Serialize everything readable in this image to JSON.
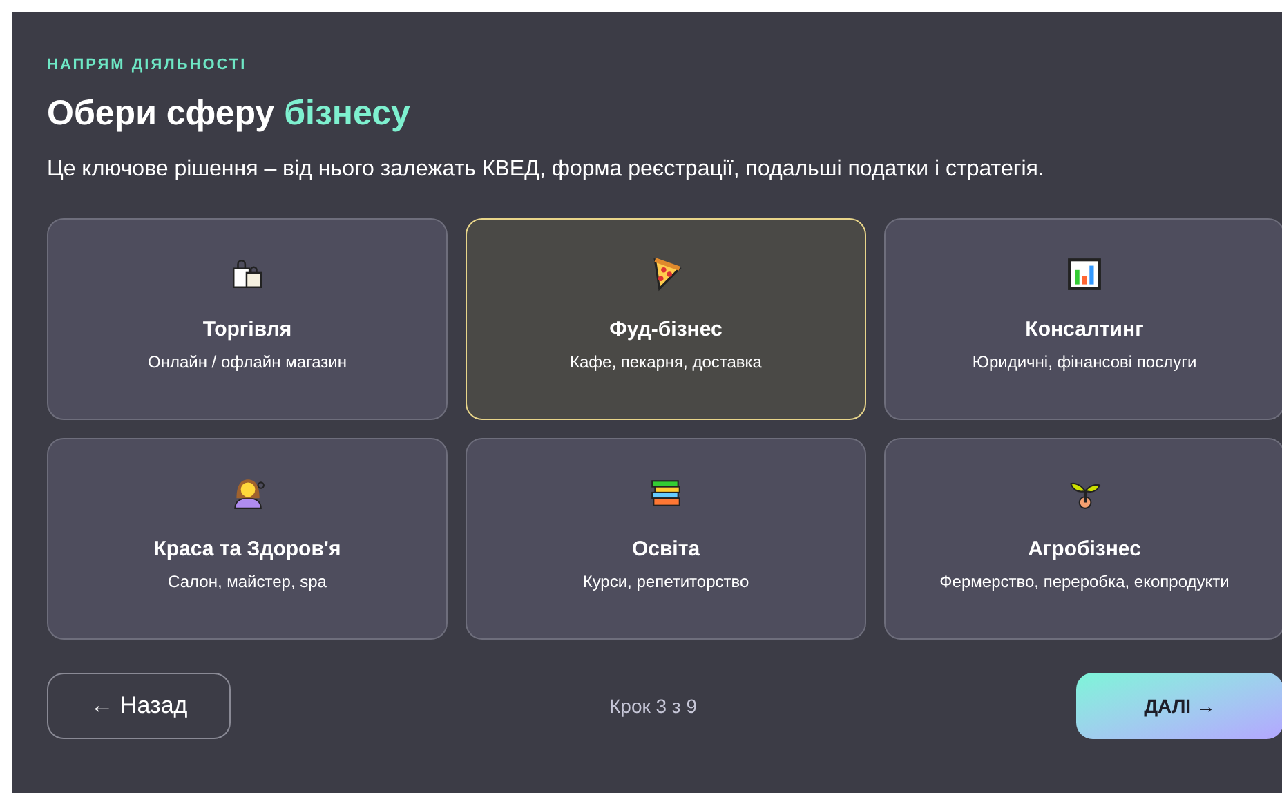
{
  "eyebrow": "НАПРЯМ ДІЯЛЬНОСТІ",
  "title": "Обери сферу",
  "title_highlight": "бізнесу",
  "description": "Це ключове рішення – від нього залежать КВЕД, форма реєстрації, подальші податки і стратегія.",
  "options": [
    {
      "kind": "bags",
      "title": "Торгівля",
      "subtitle": "Онлайн / офлайн магазин",
      "selected": false
    },
    {
      "kind": "pizza",
      "title": "Фуд-бізнес",
      "subtitle": "Кафе, пекарня, доставка",
      "selected": true
    },
    {
      "kind": "chart",
      "title": "Консалтинг",
      "subtitle": "Юридичні, фінансові послуги",
      "selected": false
    },
    {
      "kind": "person",
      "title": "Краса та Здоров'я",
      "subtitle": "Салон, майстер, spa",
      "selected": false
    },
    {
      "kind": "books",
      "title": "Освіта",
      "subtitle": "Курси, репетиторство",
      "selected": false
    },
    {
      "kind": "sprout",
      "title": "Агробізнес",
      "subtitle": "Фермерство, переробка, екопродукти",
      "selected": false
    }
  ],
  "back_button": "← Назад",
  "step": "Крок 3 з 9",
  "next_button": "ДАЛІ →"
}
